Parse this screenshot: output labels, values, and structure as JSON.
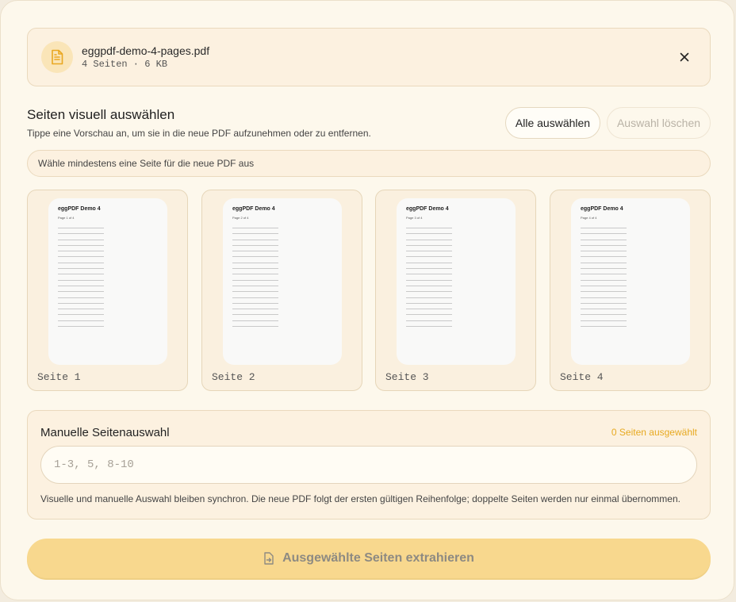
{
  "file": {
    "name": "eggpdf-demo-4-pages.pdf",
    "meta": "4 Seiten · 6 KB",
    "icon": "document-icon"
  },
  "visual": {
    "title": "Seiten visuell auswählen",
    "subtitle": "Tippe eine Vorschau an, um sie in die neue PDF aufzunehmen oder zu entfernen.",
    "select_all": "Alle auswählen",
    "clear": "Auswahl löschen",
    "hint": "Wähle mindestens eine Seite für die neue PDF aus"
  },
  "pages": [
    {
      "label": "Seite 1",
      "thumb_title": "eggPDF Demo 4",
      "thumb_sub": "Page 1 of 4"
    },
    {
      "label": "Seite 2",
      "thumb_title": "eggPDF Demo 4",
      "thumb_sub": "Page 2 of 4"
    },
    {
      "label": "Seite 3",
      "thumb_title": "eggPDF Demo 4",
      "thumb_sub": "Page 3 of 4"
    },
    {
      "label": "Seite 4",
      "thumb_title": "eggPDF Demo 4",
      "thumb_sub": "Page 4 of 4"
    }
  ],
  "manual": {
    "title": "Manuelle Seitenauswahl",
    "count": "0 Seiten ausgewählt",
    "placeholder": "1-3, 5, 8-10",
    "value": "",
    "note": "Visuelle und manuelle Auswahl bleiben synchron. Die neue PDF folgt der ersten gültigen Reihenfolge; doppelte Seiten werden nur einmal übernommen."
  },
  "extract": {
    "label": "Ausgewählte Seiten extrahieren",
    "icon": "extract-icon"
  },
  "colors": {
    "accent": "#f8d88e",
    "count": "#e7a920",
    "panel": "#fdf8ec"
  }
}
